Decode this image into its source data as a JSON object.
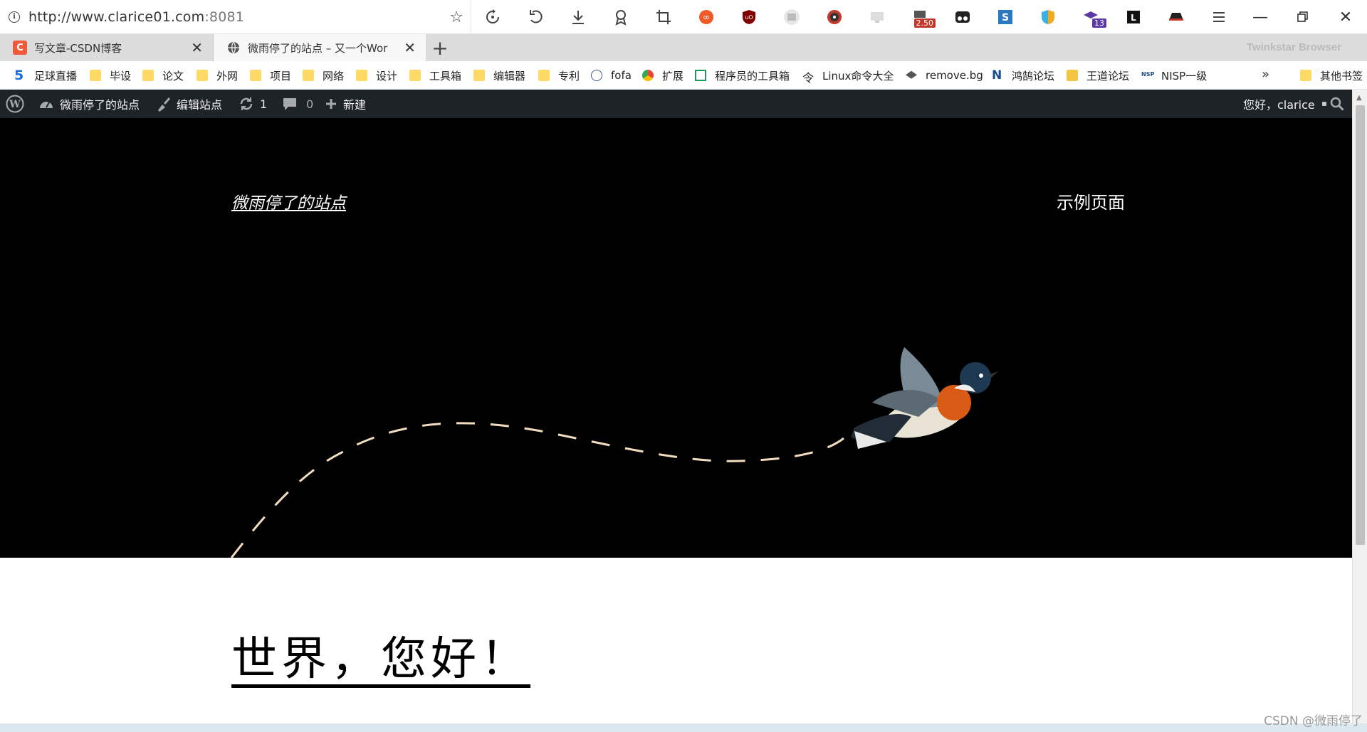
{
  "address_bar": {
    "url_host": "http://www.clarice01.com",
    "url_port": ":8081"
  },
  "extensions": {
    "badge_1": "2.50",
    "badge_2": "13"
  },
  "tabs": [
    {
      "title": "写文章-CSDN博客",
      "favicon": "C"
    },
    {
      "title": "微雨停了的站点 – 又一个Wor"
    }
  ],
  "brand": "Twinkstar Browser",
  "bookmarks": [
    {
      "label": "足球直播"
    },
    {
      "label": "毕设"
    },
    {
      "label": "论文"
    },
    {
      "label": "外网"
    },
    {
      "label": "项目"
    },
    {
      "label": "网络"
    },
    {
      "label": "设计"
    },
    {
      "label": "工具箱"
    },
    {
      "label": "编辑器"
    },
    {
      "label": "专利"
    },
    {
      "label": "fofa"
    },
    {
      "label": "扩展"
    },
    {
      "label": "程序员的工具箱"
    },
    {
      "label": "Linux命令大全"
    },
    {
      "label": "remove.bg"
    },
    {
      "label": "鸿鹄论坛"
    },
    {
      "label": "王道论坛"
    },
    {
      "label": "NISP一级"
    },
    {
      "label": "其他书签"
    }
  ],
  "adminbar": {
    "site_name": "微雨停了的站点",
    "edit_site": "编辑站点",
    "updates_count": "1",
    "comments_count": "0",
    "new_label": "新建",
    "greeting": "您好，clarice"
  },
  "hero": {
    "site_title": "微雨停了的站点",
    "menu_item": "示例页面"
  },
  "post": {
    "title": "世界，您好！"
  },
  "watermark": "CSDN @微雨停了"
}
